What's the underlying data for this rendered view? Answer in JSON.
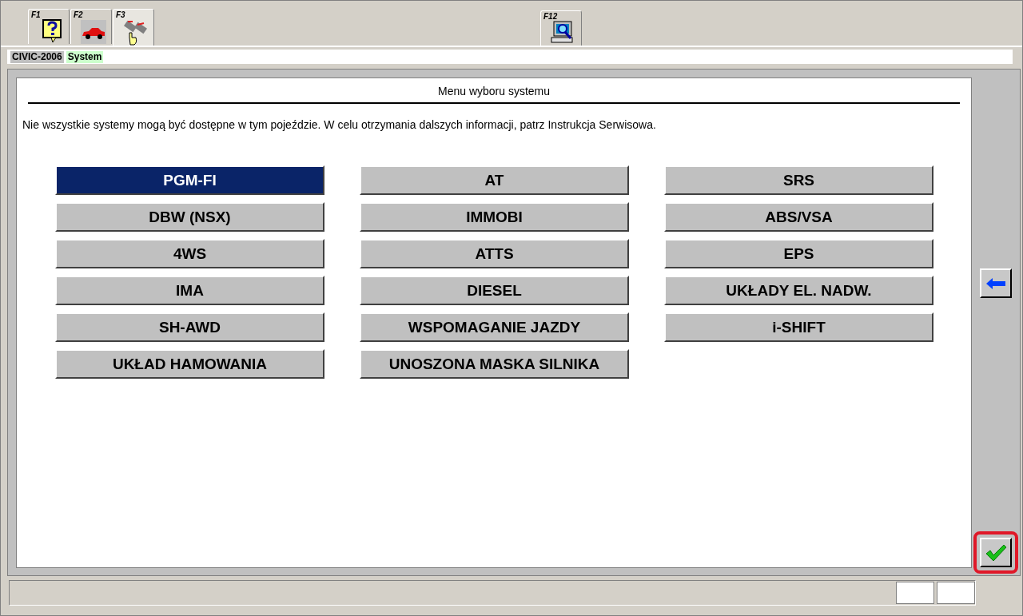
{
  "toolbar": {
    "tabs": [
      {
        "key": "F1",
        "kind": "help",
        "selected": false
      },
      {
        "key": "F2",
        "kind": "car",
        "selected": false
      },
      {
        "key": "F3",
        "kind": "systems",
        "selected": true
      },
      {
        "key": "F12",
        "kind": "computer",
        "selected": false
      }
    ]
  },
  "breadcrumb": [
    {
      "text": "CIVIC-2006",
      "color": "#c0c0c0"
    },
    {
      "text": "System",
      "color": "#ccffcc"
    }
  ],
  "panel": {
    "title": "Menu wyboru systemu",
    "notice": "Nie wszystkie systemy mogą być dostępne w tym pojeździe. W celu otrzymania dalszych informacji, patrz Instrukcja Serwisowa.",
    "columns": [
      [
        {
          "label": "PGM-FI",
          "selected": true
        },
        {
          "label": "DBW (NSX)",
          "selected": false
        },
        {
          "label": "4WS",
          "selected": false
        },
        {
          "label": "IMA",
          "selected": false
        },
        {
          "label": "SH-AWD",
          "selected": false
        },
        {
          "label": "UKŁAD HAMOWANIA",
          "selected": false
        }
      ],
      [
        {
          "label": "AT",
          "selected": false
        },
        {
          "label": "IMMOBI",
          "selected": false
        },
        {
          "label": "ATTS",
          "selected": false
        },
        {
          "label": "DIESEL",
          "selected": false
        },
        {
          "label": "WSPOMAGANIE JAZDY",
          "selected": false
        },
        {
          "label": "UNOSZONA MASKA SILNIKA",
          "selected": false
        }
      ],
      [
        {
          "label": "SRS",
          "selected": false
        },
        {
          "label": "ABS/VSA",
          "selected": false
        },
        {
          "label": "EPS",
          "selected": false
        },
        {
          "label": "UKŁADY EL. NADW.",
          "selected": false
        },
        {
          "label": "i-SHIFT",
          "selected": false
        }
      ]
    ]
  },
  "side_buttons": [
    {
      "kind": "back",
      "highlighted": false
    },
    {
      "kind": "confirm",
      "highlighted": true
    }
  ]
}
